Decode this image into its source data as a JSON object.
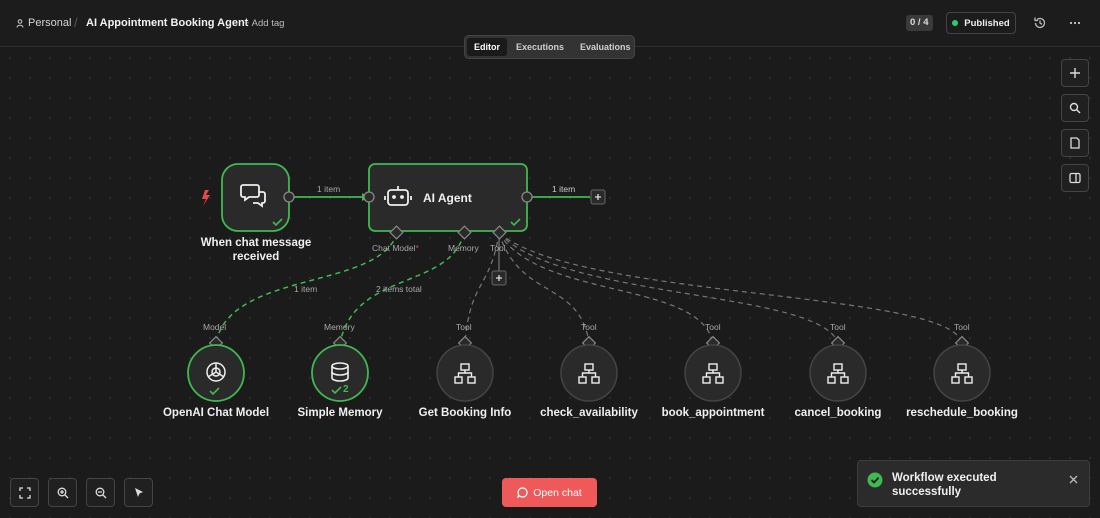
{
  "header": {
    "workspace": "Personal",
    "separator": "/",
    "workflow_title": "AI Appointment Booking Agent",
    "add_tag": "+ Add tag",
    "counter": "0 / 4",
    "status": "Published",
    "status_color": "#2ecc71"
  },
  "tabs": [
    {
      "label": "Editor",
      "active": true
    },
    {
      "label": "Executions",
      "active": false
    },
    {
      "label": "Evaluations",
      "active": false
    }
  ],
  "nodes": {
    "trigger": {
      "label_line1": "When chat message",
      "label_line2": "received",
      "icon": "chat-bubbles-icon"
    },
    "agent": {
      "label": "AI Agent",
      "icon": "robot-icon"
    },
    "chat_model": {
      "label": "OpenAI Chat Model",
      "icon": "openai-icon",
      "port_label": "Model"
    },
    "memory": {
      "label": "Simple Memory",
      "icon": "database-icon",
      "port_label": "Memory",
      "badge": "2"
    },
    "tools": [
      {
        "label": "Get Booking Info",
        "port_label": "Tool"
      },
      {
        "label": "check_availability",
        "port_label": "Tool"
      },
      {
        "label": "book_appointment",
        "port_label": "Tool"
      },
      {
        "label": "cancel_booking",
        "port_label": "Tool"
      },
      {
        "label": "reschedule_booking",
        "port_label": "Tool"
      }
    ]
  },
  "agent_ports": {
    "chat_model": "Chat Model",
    "required_mark": "*",
    "memory": "Memory",
    "tool": "Tool"
  },
  "connections": {
    "trigger_to_agent": "1 item",
    "agent_output": "1 item",
    "model_link": "1 item",
    "memory_link": "2 items total"
  },
  "actions": {
    "open_chat": "Open chat"
  },
  "toast": {
    "message_line1": "Workflow executed",
    "message_line2": "successfully"
  },
  "colors": {
    "success": "#3fb950",
    "accent": "#f0595a",
    "trigger": "#e5484d"
  }
}
